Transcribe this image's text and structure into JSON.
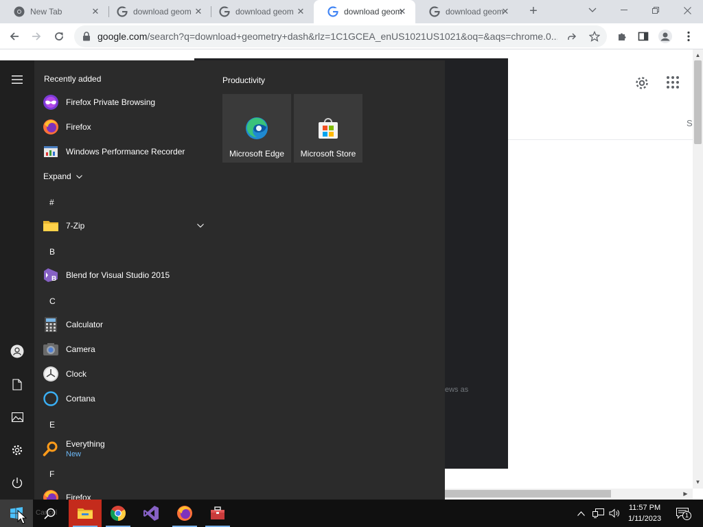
{
  "browser": {
    "tabs": [
      {
        "title": "New Tab",
        "favicon": "chrome-icon",
        "active": false
      },
      {
        "title": "download geom",
        "favicon": "google-g-icon",
        "active": false
      },
      {
        "title": "download geom",
        "favicon": "google-g-icon",
        "active": false
      },
      {
        "title": "download geom",
        "favicon": "google-g-icon",
        "active": true
      },
      {
        "title": "download geom",
        "favicon": "google-g-icon",
        "active": false
      }
    ],
    "close_glyph": "✕",
    "new_tab_glyph": "+",
    "url": {
      "domain": "google.com",
      "rest": "/search?q=download+geometry+dash&rlz=1C1GCEA_enUS1021US1021&oq=&aqs=chrome.0...."
    }
  },
  "google_page": {
    "partial_tab_letter": "S",
    "snippet_fragment": "ews as"
  },
  "start_menu": {
    "recently_added_heading": "Recently added",
    "recently_added": [
      {
        "label": "Firefox Private Browsing",
        "icon": "firefox-private-icon"
      },
      {
        "label": "Firefox",
        "icon": "firefox-icon"
      },
      {
        "label": "Windows Performance Recorder",
        "icon": "performance-recorder-icon"
      }
    ],
    "expand_label": "Expand",
    "sections": [
      {
        "letter": "#",
        "apps": [
          {
            "label": "7-Zip",
            "icon": "folder-icon",
            "has_chevron": true
          }
        ]
      },
      {
        "letter": "B",
        "apps": [
          {
            "label": "Blend for Visual Studio 2015",
            "icon": "blend-icon"
          }
        ]
      },
      {
        "letter": "C",
        "apps": [
          {
            "label": "Calculator",
            "icon": "calculator-icon"
          },
          {
            "label": "Camera",
            "icon": "camera-icon"
          },
          {
            "label": "Clock",
            "icon": "clock-icon"
          },
          {
            "label": "Cortana",
            "icon": "cortana-icon"
          }
        ]
      },
      {
        "letter": "E",
        "apps": [
          {
            "label": "Everything",
            "sub": "New",
            "icon": "everything-search-icon"
          }
        ]
      },
      {
        "letter": "F",
        "apps": [
          {
            "label": "Firefox",
            "icon": "firefox-icon"
          }
        ]
      }
    ],
    "tile_group_heading": "Productivity",
    "tiles": [
      {
        "label": "Microsoft Edge",
        "icon": "edge-icon"
      },
      {
        "label": "Microsoft Store",
        "icon": "store-icon"
      }
    ]
  },
  "taskbar": {
    "ghost_text": "Cancel",
    "time": "11:57 PM",
    "date": "1/11/2023",
    "notification_count": "1"
  }
}
